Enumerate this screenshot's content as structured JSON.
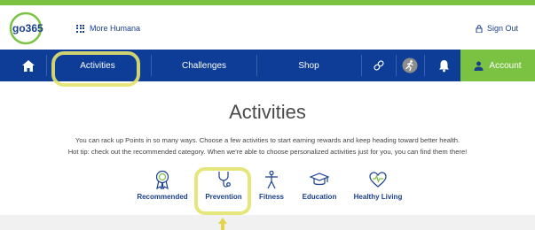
{
  "header": {
    "logo_text": "go365",
    "more_humana": "More Humana",
    "sign_out": "Sign Out"
  },
  "nav": {
    "home_icon": "home-icon",
    "activities": "Activities",
    "challenges": "Challenges",
    "shop": "Shop",
    "link_icon": "link-icon",
    "runner_icon": "runner-icon",
    "bell_icon": "bell-icon",
    "account": "Account"
  },
  "page": {
    "title": "Activities",
    "description_line1": "You can rack up Points in so many ways. Choose a few activities to start earning rewards and keep heading toward better health.",
    "description_line2": "Hot tip: check out the recommended category. When we're able to choose personalized activities just for you, you can find them there!"
  },
  "categories": [
    {
      "label": "Recommended",
      "icon": "award-ribbon-icon"
    },
    {
      "label": "Prevention",
      "icon": "stethoscope-icon"
    },
    {
      "label": "Fitness",
      "icon": "fitness-person-icon"
    },
    {
      "label": "Education",
      "icon": "graduation-cap-icon"
    },
    {
      "label": "Healthy Living",
      "icon": "heart-pulse-icon"
    }
  ],
  "colors": {
    "nav_blue": "#0d3d97",
    "accent_green": "#7cc242",
    "highlight_yellow": "#e4e36e",
    "link_blue": "#1a3f8c"
  }
}
